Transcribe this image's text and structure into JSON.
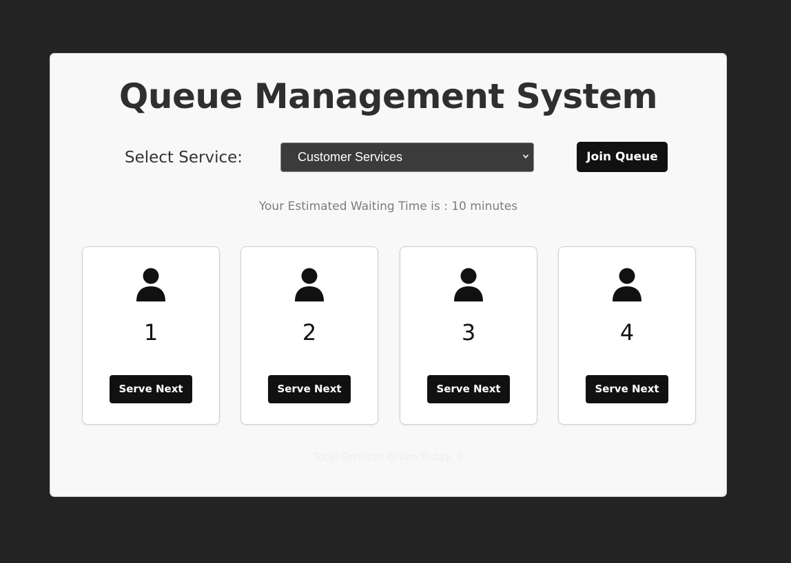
{
  "header": {
    "title": "Queue Management System"
  },
  "service": {
    "label": "Select Service:",
    "selected": "Customer Services",
    "join_label": "Join Queue"
  },
  "waiting": {
    "text": "Your Estimated Waiting Time is : 10 minutes"
  },
  "counters": [
    {
      "number": "1",
      "button": "Serve Next"
    },
    {
      "number": "2",
      "button": "Serve Next"
    },
    {
      "number": "3",
      "button": "Serve Next"
    },
    {
      "number": "4",
      "button": "Serve Next"
    }
  ],
  "footer": {
    "total_text": "Total Services Given Today: 0"
  },
  "icons": {
    "counter": "person-icon",
    "select": "chevron-down-icon"
  },
  "colors": {
    "page_background": "#232323",
    "panel_background": "#f8f8f8",
    "button": "#111111",
    "select_background": "#3b3b3b"
  }
}
